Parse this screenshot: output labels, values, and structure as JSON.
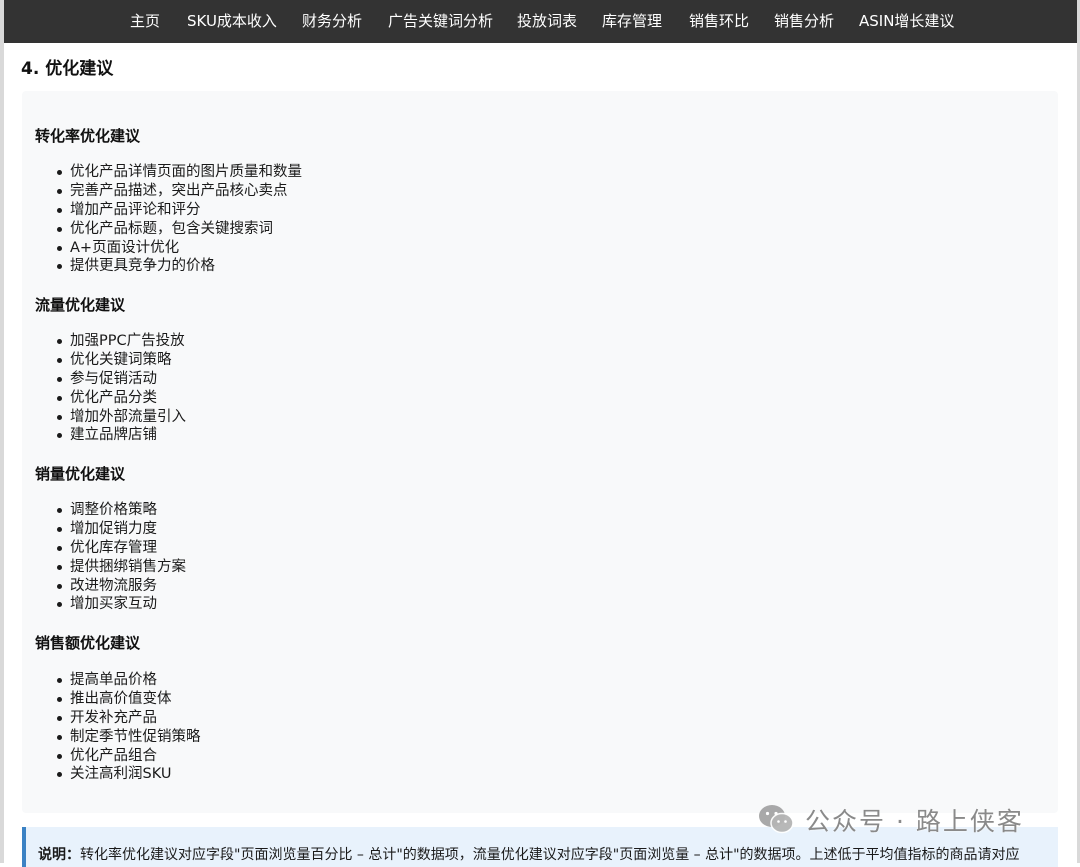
{
  "nav": {
    "items": [
      "主页",
      "SKU成本收入",
      "财务分析",
      "广告关键词分析",
      "投放词表",
      "库存管理",
      "销售环比",
      "销售分析",
      "ASIN增长建议"
    ]
  },
  "section": {
    "title": "4. 优化建议"
  },
  "groups": [
    {
      "title": "转化率优化建议",
      "items": [
        "优化产品详情页面的图片质量和数量",
        "完善产品描述，突出产品核心卖点",
        "增加产品评论和评分",
        "优化产品标题，包含关键搜索词",
        "A+页面设计优化",
        "提供更具竞争力的价格"
      ]
    },
    {
      "title": "流量优化建议",
      "items": [
        "加强PPC广告投放",
        "优化关键词策略",
        "参与促销活动",
        "优化产品分类",
        "增加外部流量引入",
        "建立品牌店铺"
      ]
    },
    {
      "title": "销量优化建议",
      "items": [
        "调整价格策略",
        "增加促销力度",
        "优化库存管理",
        "提供捆绑销售方案",
        "改进物流服务",
        "增加买家互动"
      ]
    },
    {
      "title": "销售额优化建议",
      "items": [
        "提高单品价格",
        "推出高价值变体",
        "开发补充产品",
        "制定季节性促销策略",
        "优化产品组合",
        "关注高利润SKU"
      ]
    }
  ],
  "note": {
    "label": "说明：",
    "text": "转化率优化建议对应字段\"页面浏览量百分比 – 总计\"的数据项，流量优化建议对应字段\"页面浏览量 – 总计\"的数据项。上述低于平均值指标的商品请对应"
  },
  "watermark": {
    "text": "公众号 · 路上侠客",
    "icon": "wechat-icon"
  },
  "colors": {
    "navbar": "#333333",
    "panel": "#f8f9fa",
    "note_bg": "#e8f2fc",
    "note_border": "#3b82c4"
  }
}
